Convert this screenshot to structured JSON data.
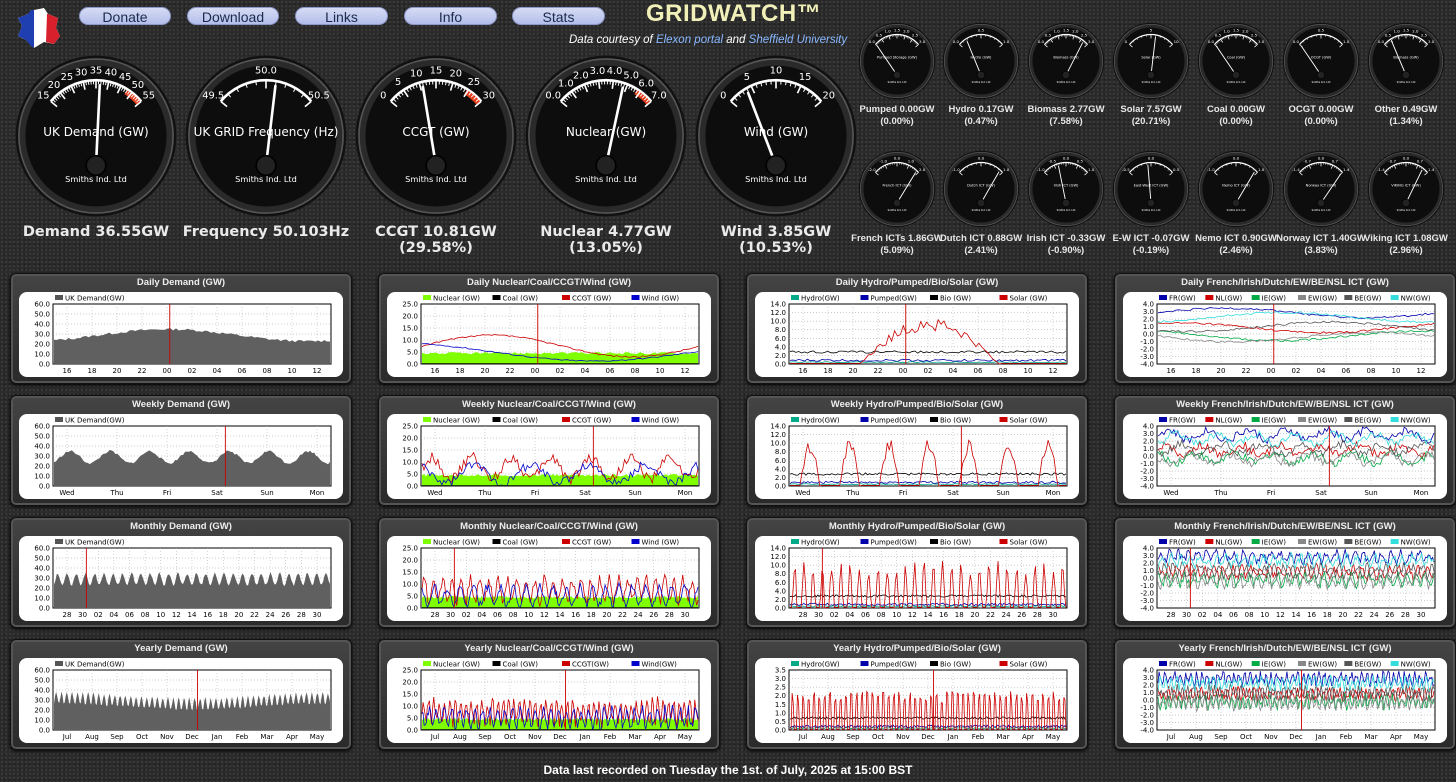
{
  "nav": {
    "donate": "Donate",
    "download": "Download",
    "links": "Links",
    "info": "Info",
    "stats": "Stats"
  },
  "brand": "GRIDWATCH™",
  "courtesy": {
    "prefix": "Data courtesy of",
    "elexon": "Elexon portal",
    "and": "and",
    "sheffield": "Sheffield University"
  },
  "colors": {
    "nuclear": "#80ff00",
    "coal": "#000000",
    "ccgt": "#cc0000",
    "wind": "#0000cc",
    "hydro": "#00aa88",
    "pumped": "#0000aa",
    "bio": "#000000",
    "solar": "#cc0000",
    "fr": "#0000aa",
    "nl": "#cc0000",
    "ie": "#00aa44",
    "ew": "#888888",
    "be": "#555555",
    "nw": "#33dddd",
    "demand": "#555555"
  },
  "big_gauges": [
    {
      "label": "UK Demand (GW)",
      "maker": "Smiths Ind. Ltd",
      "ticks": [
        "15",
        "20",
        "25",
        "30",
        "35",
        "40",
        "45",
        "50",
        "55"
      ],
      "value_fraction": 0.54,
      "caption1": "Demand 36.55GW",
      "caption2": ""
    },
    {
      "label": "UK GRID Frequency (Hz)",
      "maker": "Smiths Ind. Ltd",
      "ticks": [
        "49.5",
        "50.0",
        "50.5"
      ],
      "value_fraction": 0.6,
      "caption1": "Frequency 50.103Hz",
      "caption2": ""
    },
    {
      "label": "CCGT (GW)",
      "maker": "Smiths Ind. Ltd",
      "ticks": [
        "0",
        "5",
        "10",
        "15",
        "20",
        "25",
        "30"
      ],
      "value_fraction": 0.36,
      "caption1": "CCGT 10.81GW",
      "caption2": "(29.58%)"
    },
    {
      "label": "Nuclear (GW)",
      "maker": "Smiths Ind. Ltd",
      "ticks": [
        "0.0",
        "1.0",
        "2.0",
        "3.0",
        "4.0",
        "5.0",
        "6.0",
        "7.0"
      ],
      "value_fraction": 0.68,
      "caption1": "Nuclear 4.77GW",
      "caption2": "(13.05%)"
    },
    {
      "label": "Wind (GW)",
      "maker": "Smiths Ind. Ltd",
      "ticks": [
        "0",
        "5",
        "10",
        "15",
        "20"
      ],
      "value_fraction": 0.19,
      "caption1": "Wind 3.85GW",
      "caption2": "(10.53%)"
    }
  ],
  "small_gauges_row1": [
    {
      "label": "Pumped Storage (GW)",
      "ticks": [
        "0.0",
        "0.5",
        "1.0",
        "1.5",
        "2.0",
        "2.5",
        "3.0"
      ],
      "value_fraction": 0.0,
      "caption1": "Pumped 0.00GW",
      "caption2": "(0.00%)"
    },
    {
      "label": "Hydro (GW)",
      "ticks": [
        "0.0",
        "0.5",
        "1.0"
      ],
      "value_fraction": 0.17,
      "caption1": "Hydro 0.17GW",
      "caption2": "(0.47%)"
    },
    {
      "label": "Biomass (GW)",
      "ticks": [
        "0.0",
        "0.5",
        "1.0",
        "1.5",
        "2.0",
        "2.5",
        "3.0"
      ],
      "value_fraction": 0.9,
      "caption1": "Biomass 2.77GW",
      "caption2": "(7.58%)"
    },
    {
      "label": "Solar (GW)",
      "ticks": [
        "0",
        "5",
        "10"
      ],
      "value_fraction": 0.6,
      "caption1": "Solar 7.57GW",
      "caption2": "(20.71%)"
    },
    {
      "label": "Coal (GW)",
      "ticks": [
        "0.0",
        "0.5",
        "1.0",
        "1.5",
        "2.0",
        "2.5",
        "3.0"
      ],
      "value_fraction": 0.0,
      "caption1": "Coal 0.00GW",
      "caption2": "(0.00%)"
    },
    {
      "label": "OCGT (GW)",
      "ticks": [
        "0.0",
        "0.5",
        "1.0"
      ],
      "value_fraction": 0.0,
      "caption1": "OCGT 0.00GW",
      "caption2": "(0.00%)"
    },
    {
      "label": "Biomass (GW)",
      "ticks": [
        "0.0",
        "0.5",
        "1.0",
        "1.5",
        "2.0",
        "2.5",
        "3.0"
      ],
      "value_fraction": 0.16,
      "caption1": "Other 0.49GW",
      "caption2": "(1.34%)"
    }
  ],
  "small_gauges_row2": [
    {
      "label": "French ICT (GW)",
      "ticks": [
        "-2.0",
        "-1.0",
        "0.0",
        "1.0",
        "2.0"
      ],
      "value_fraction": 0.96,
      "caption1": "French ICTs 1.86GW",
      "caption2": "(5.09%)"
    },
    {
      "label": "Dutch ICT (GW)",
      "ticks": [
        "-1.0",
        "0.0",
        "1.0"
      ],
      "value_fraction": 0.94,
      "caption1": "Dutch ICT 0.88GW",
      "caption2": "(2.41%)"
    },
    {
      "label": "Irish ICT (GW)",
      "ticks": [
        "-1.0",
        "-0.5",
        "0.0",
        "0.5",
        "1.0"
      ],
      "value_fraction": 0.33,
      "caption1": "Irish ICT -0.33GW",
      "caption2": "(-0.90%)"
    },
    {
      "label": "East-West ICT (GW)",
      "ticks": [
        "-0.5",
        "0.0",
        "0.5"
      ],
      "value_fraction": 0.43,
      "caption1": "E-W ICT -0.07GW",
      "caption2": "(-0.19%)"
    },
    {
      "label": "Nemo ICT (GW)",
      "ticks": [
        "-1.0",
        "0.0",
        "1.0"
      ],
      "value_fraction": 0.95,
      "caption1": "Nemo ICT 0.90GW",
      "caption2": "(2.46%)"
    },
    {
      "label": "Norway ICT (GW)",
      "ticks": [
        "-1.4",
        "-0.7",
        "0.0",
        "0.7",
        "1.4"
      ],
      "value_fraction": 1.0,
      "caption1": "Norway ICT 1.40GW",
      "caption2": "(3.83%)"
    },
    {
      "label": "VIKING ICT (GW)",
      "ticks": [
        "-1.4",
        "-0.7",
        "0.0",
        "0.7",
        "1.4"
      ],
      "value_fraction": 0.88,
      "caption1": "Viking ICT 1.08GW",
      "caption2": "(2.96%)"
    }
  ],
  "small_maker": "Smiths Ind. Ltd",
  "x_labels": {
    "daily": [
      "16",
      "18",
      "20",
      "22",
      "00",
      "02",
      "04",
      "06",
      "08",
      "10",
      "12"
    ],
    "weekly": [
      "Wed",
      "Thu",
      "Fri",
      "Sat",
      "Sun",
      "Mon"
    ],
    "monthly": [
      "28",
      "30",
      "02",
      "04",
      "06",
      "08",
      "10",
      "12",
      "14",
      "16",
      "18",
      "20",
      "22",
      "24",
      "26",
      "28",
      "30"
    ],
    "yearly": [
      "Jul",
      "Aug",
      "Sep",
      "Oct",
      "Nov",
      "Dec",
      "Jan",
      "Feb",
      "Mar",
      "Apr",
      "May"
    ]
  },
  "panels": [
    {
      "title": "Daily Demand (GW)",
      "kind": "demand",
      "period": "daily",
      "yticks": [
        "60.0",
        "50.0",
        "40.0",
        "30.0",
        "20.0",
        "10.0",
        "0.0"
      ],
      "legend": [
        "UK Demand(GW)"
      ]
    },
    {
      "title": "Daily Nuclear/Coal/CCGT/Wind (GW)",
      "kind": "ncw",
      "period": "daily",
      "yticks": [
        "25.0",
        "20.0",
        "15.0",
        "10.0",
        "5.0",
        "0.0"
      ],
      "legend": [
        "Nuclear (GW)",
        "Coal (GW)",
        "CCGT (GW)",
        "Wind (GW)"
      ]
    },
    {
      "title": "Daily Hydro/Pumped/Bio/Solar (GW)",
      "kind": "hpbs",
      "period": "daily",
      "yticks": [
        "14.0",
        "12.0",
        "10.0",
        "8.0",
        "6.0",
        "4.0",
        "2.0",
        "0.0"
      ],
      "legend": [
        "Hydro(GW)",
        "Pumped(GW)",
        "Bio (GW)",
        "Solar (GW)"
      ]
    },
    {
      "title": "Daily French/Irish/Dutch/EW/BE/NSL ICT (GW)",
      "kind": "ict",
      "period": "daily",
      "yticks": [
        "4.0",
        "3.0",
        "2.0",
        "1.0",
        "0.0",
        "-1.0",
        "-2.0",
        "-3.0",
        "-4.0"
      ],
      "legend": [
        "FR(GW)",
        "NL(GW)",
        "IE(GW)",
        "EW(GW)",
        "BE(GW)",
        "NW(GW)"
      ]
    },
    {
      "title": "Weekly Demand (GW)",
      "kind": "demand",
      "period": "weekly",
      "yticks": [
        "60.0",
        "50.0",
        "40.0",
        "30.0",
        "20.0",
        "10.0",
        "0.0"
      ],
      "legend": [
        "UK Demand(GW)"
      ]
    },
    {
      "title": "Weekly Nuclear/Coal/CCGT/Wind (GW)",
      "kind": "ncw",
      "period": "weekly",
      "yticks": [
        "25.0",
        "20.0",
        "15.0",
        "10.0",
        "5.0",
        "0.0"
      ],
      "legend": [
        "Nuclear (GW)",
        "Coal (GW)",
        "CCGT (GW)",
        "Wind (GW)"
      ]
    },
    {
      "title": "Weekly Hydro/Pumped/Bio/Solar (GW)",
      "kind": "hpbs",
      "period": "weekly",
      "yticks": [
        "14.0",
        "12.0",
        "10.0",
        "8.0",
        "6.0",
        "4.0",
        "2.0",
        "0.0"
      ],
      "legend": [
        "Hydro(GW)",
        "Pumped(GW)",
        "Bio (GW)",
        "Solar (GW)"
      ]
    },
    {
      "title": "Weekly French/Irish/Dutch/EW/BE/NSL ICT (GW)",
      "kind": "ict",
      "period": "weekly",
      "yticks": [
        "4.0",
        "3.0",
        "2.0",
        "1.0",
        "0.0",
        "-1.0",
        "-2.0",
        "-3.0",
        "-4.0"
      ],
      "legend": [
        "FR(GW)",
        "NL(GW)",
        "IE(GW)",
        "EW(GW)",
        "BE(GW)",
        "NW(GW)"
      ]
    },
    {
      "title": "Monthly Demand (GW)",
      "kind": "demand",
      "period": "monthly",
      "yticks": [
        "60.0",
        "50.0",
        "40.0",
        "30.0",
        "20.0",
        "10.0",
        "0.0"
      ],
      "legend": [
        "UK Demand(GW)"
      ]
    },
    {
      "title": "Monthly Nuclear/Coal/CCGT/Wind (GW)",
      "kind": "ncw",
      "period": "monthly",
      "yticks": [
        "25.0",
        "20.0",
        "15.0",
        "10.0",
        "5.0",
        "0.0"
      ],
      "legend": [
        "Nuclear (GW)",
        "Coal (GW)",
        "CCGT (GW)",
        "Wind (GW)"
      ]
    },
    {
      "title": "Monthly Hydro/Pumped/Bio/Solar (GW)",
      "kind": "hpbs",
      "period": "monthly",
      "yticks": [
        "14.0",
        "12.0",
        "10.0",
        "8.0",
        "6.0",
        "4.0",
        "2.0",
        "0.0"
      ],
      "legend": [
        "Hydro(GW)",
        "Pumped(GW)",
        "Bio (GW)",
        "Solar (GW)"
      ]
    },
    {
      "title": "Monthly French/Irish/Dutch/EW/BE/NSL ICT (GW)",
      "kind": "ict",
      "period": "monthly",
      "yticks": [
        "4.0",
        "3.0",
        "2.0",
        "1.0",
        "0.0",
        "-1.0",
        "-2.0",
        "-3.0",
        "-4.0"
      ],
      "legend": [
        "FR(GW)",
        "NL(GW)",
        "IE(GW)",
        "EW(GW)",
        "BE(GW)",
        "NW(GW)"
      ]
    },
    {
      "title": "Yearly Demand (GW)",
      "kind": "demand",
      "period": "yearly",
      "yticks": [
        "60.0",
        "50.0",
        "40.0",
        "30.0",
        "20.0",
        "10.0",
        "0.0"
      ],
      "legend": [
        "UK Demand(GW)"
      ]
    },
    {
      "title": "Yearly Nuclear/Coal/CCGT/Wind (GW)",
      "kind": "ncw",
      "period": "yearly",
      "yticks": [
        "25.0",
        "20.0",
        "15.0",
        "10.0",
        "5.0",
        "0.0"
      ],
      "legend": [
        "Nuclear (GW)",
        "Coal (GW)",
        "CCGT(GW)",
        "Wind(GW)"
      ]
    },
    {
      "title": "Yearly Hydro/Pumped/Bio/Solar (GW)",
      "kind": "hpbs",
      "period": "yearly",
      "yticks": [
        "3.5",
        "3.0",
        "2.5",
        "2.0",
        "1.5",
        "1.0",
        "0.5",
        "0.0"
      ],
      "legend": [
        "Hydro(GW)",
        "Pumped(GW)",
        "Bio (GW)",
        "Solar (GW)"
      ]
    },
    {
      "title": "Yearly French/Irish/Dutch/EW/BE/NSL ICT (GW)",
      "kind": "ict",
      "period": "yearly",
      "yticks": [
        "4.0",
        "3.0",
        "2.0",
        "1.0",
        "0.0",
        "-1.0",
        "-2.0",
        "-3.0",
        "-4.0"
      ],
      "legend": [
        "FR(GW)",
        "NL(GW)",
        "IE(GW)",
        "EW(GW)",
        "BE(GW)",
        "NW(GW)"
      ]
    }
  ],
  "footer": "Data last recorded on Tuesday the 1st. of July, 2025 at 15:00 BST"
}
